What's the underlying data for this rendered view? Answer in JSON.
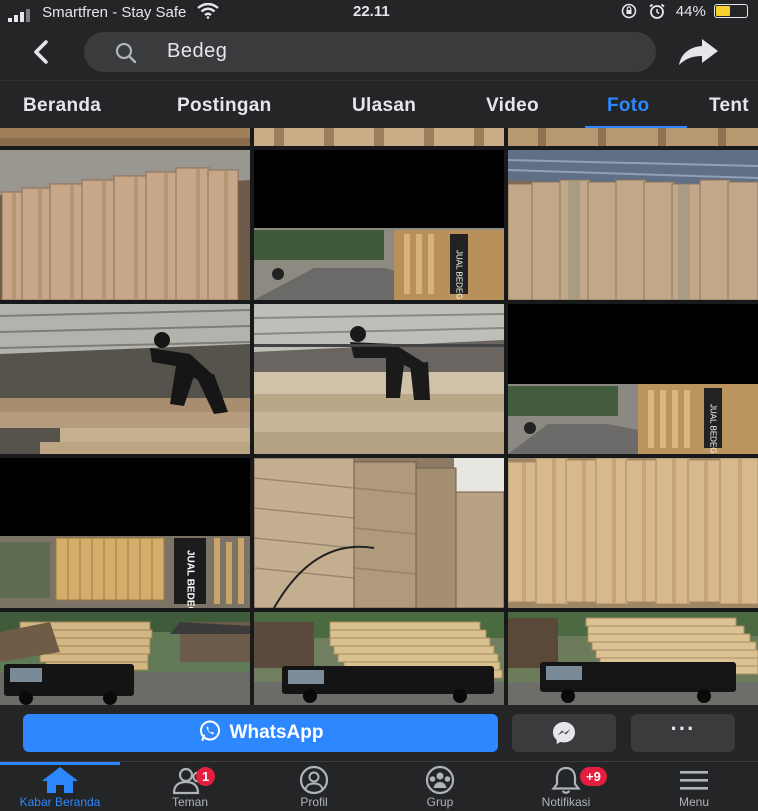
{
  "status_bar": {
    "carrier": "Smartfren - Stay Safe",
    "time": "22.11",
    "battery_text": "44%",
    "battery_level": 0.44
  },
  "header": {
    "search_query": "Bedeg",
    "back_icon": "chevron-left-icon",
    "share_icon": "share-arrow-icon"
  },
  "tabs": [
    {
      "label": "Beranda",
      "active": false
    },
    {
      "label": "Postingan",
      "active": false
    },
    {
      "label": "Ulasan",
      "active": false
    },
    {
      "label": "Video",
      "active": false
    },
    {
      "label": "Foto",
      "active": true
    },
    {
      "label": "Tent",
      "active": false
    }
  ],
  "photo_signs": {
    "sign_1": "JUAL BEDEG",
    "sign_2": "JUAL BEDEG",
    "sign_3": "JUAL BEDEG"
  },
  "actions": {
    "whatsapp_label": "WhatsApp",
    "more_label": "···"
  },
  "bottom_nav": [
    {
      "label": "Kabar Beranda",
      "icon": "home-icon",
      "active": true,
      "badge": ""
    },
    {
      "label": "Teman",
      "icon": "friends-icon",
      "active": false,
      "badge": "1"
    },
    {
      "label": "Profil",
      "icon": "profile-icon",
      "active": false,
      "badge": ""
    },
    {
      "label": "Grup",
      "icon": "groups-icon",
      "active": false,
      "badge": ""
    },
    {
      "label": "Notifikasi",
      "icon": "bell-icon",
      "active": false,
      "badge": "+9"
    },
    {
      "label": "Menu",
      "icon": "menu-icon",
      "active": false,
      "badge": ""
    }
  ],
  "colors": {
    "accent": "#2d88ff",
    "background": "#18191a",
    "surface": "#242526",
    "badge": "#e41e3f",
    "battery": "#f7d12e"
  }
}
